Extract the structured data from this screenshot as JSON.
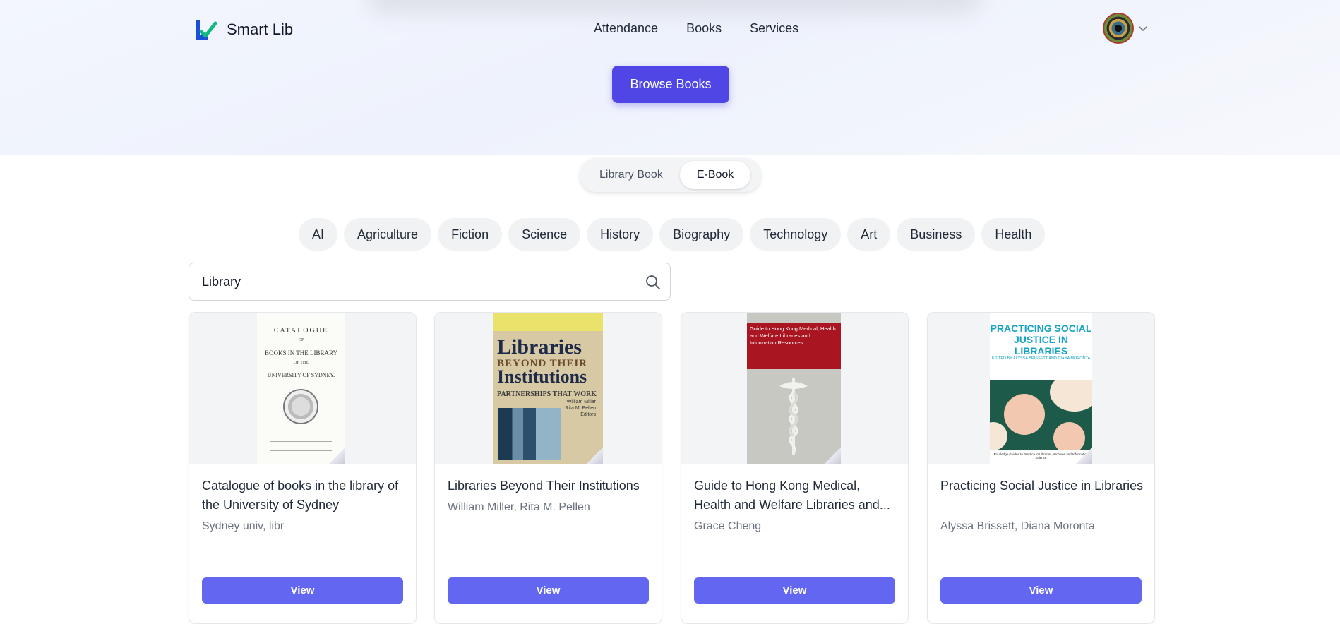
{
  "brand": {
    "name": "Smart Lib",
    "logo_icon": "smart-lib-logo-icon"
  },
  "nav": [
    {
      "label": "Attendance"
    },
    {
      "label": "Books"
    },
    {
      "label": "Services"
    }
  ],
  "user": {
    "avatar_icon": "avatar",
    "menu_icon": "chevron-down-icon"
  },
  "hero": {
    "browse_label": "Browse Books"
  },
  "toggle": {
    "options": [
      "Library Book",
      "E-Book"
    ],
    "selected": "E-Book"
  },
  "categories": [
    "AI",
    "Agriculture",
    "Fiction",
    "Science",
    "History",
    "Biography",
    "Technology",
    "Art",
    "Business",
    "Health"
  ],
  "search": {
    "value": "Library",
    "icon": "search-icon"
  },
  "books": [
    {
      "title": "Catalogue of books in the library of the University of Sydney",
      "author": "Sydney univ, libr",
      "button": "View",
      "cover_text": [
        "CATALOGUE",
        "OF",
        "BOOKS IN THE LIBRARY",
        "OF THE",
        "UNIVERSITY OF SYDNEY."
      ]
    },
    {
      "title": "Libraries Beyond Their Institutions",
      "author": "William Miller, Rita M. Pellen",
      "button": "View",
      "cover_text": [
        "Libraries",
        "BEYOND THEIR",
        "Institutions",
        "PARTNERSHIPS THAT WORK",
        "William Miller",
        "Rita M. Pellen",
        "Editors"
      ]
    },
    {
      "title": "Guide to Hong Kong Medical, Health and Welfare Libraries and...",
      "author": "Grace Cheng",
      "button": "View",
      "cover_text": [
        "Guide to Hong Kong Medical, Health and Welfare Libraries and Information Resources"
      ]
    },
    {
      "title": "Practicing Social Justice in Libraries",
      "author": "Alyssa Brissett, Diana Moronta",
      "button": "View",
      "cover_text": [
        "PRACTICING SOCIAL JUSTICE IN LIBRARIES",
        "EDITED BY ALYSSA BRISSETT AND DIANA MORONTA",
        "Routledge Guides to Practice in Libraries, Archives and Information Science"
      ]
    }
  ],
  "colors": {
    "primary": "#4f46e5",
    "view_button": "#6366f1",
    "logo_blue": "#1d4ed8",
    "logo_green": "#10b981"
  }
}
